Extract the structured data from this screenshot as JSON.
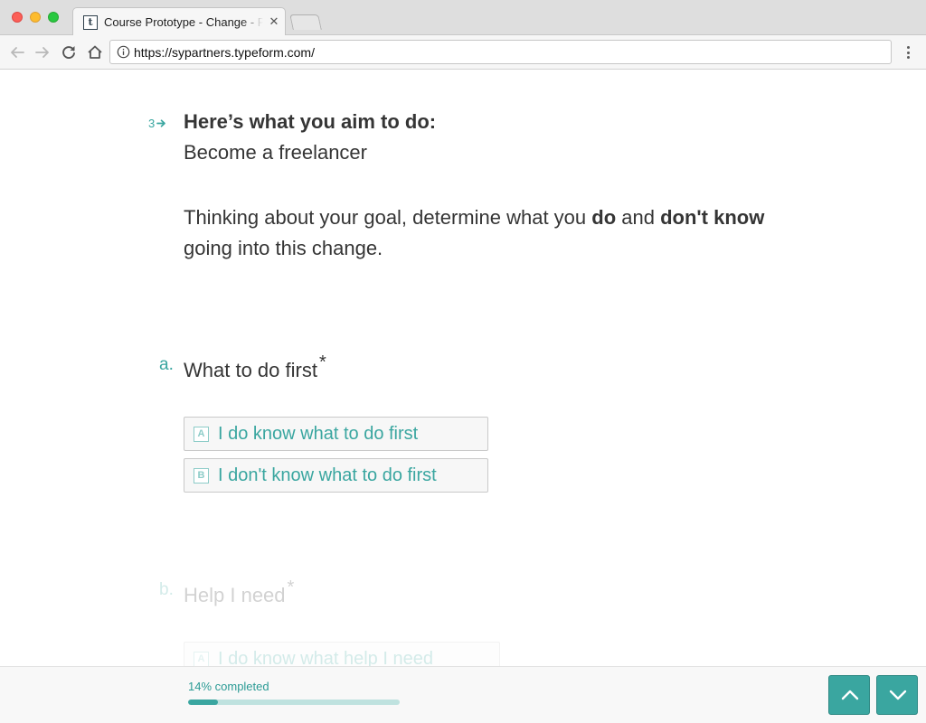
{
  "browser": {
    "tab_title": "Course Prototype - Change - P",
    "tab_favicon_letter": "t",
    "url": "https://sypartners.typeform.com/"
  },
  "question": {
    "number": "3",
    "title": "Here’s what you aim to do:",
    "goal": "Become a freelancer",
    "description_part1": "Thinking about your goal, determine what you ",
    "description_bold1": "do",
    "description_part2": " and ",
    "description_bold2": "don't know",
    "description_part3": " going into this change."
  },
  "subquestions": [
    {
      "letter": "a.",
      "title": "What to do first",
      "required_mark": "*",
      "choices": [
        {
          "key": "A",
          "label": "I do know what to do first"
        },
        {
          "key": "B",
          "label": "I don't know what to do first"
        }
      ]
    },
    {
      "letter": "b.",
      "title": "Help I need",
      "required_mark": "*",
      "choices": [
        {
          "key": "A",
          "label": "I do know what help I need"
        }
      ]
    }
  ],
  "footer": {
    "progress_label": "14% completed",
    "progress_fraction": 0.14
  },
  "colors": {
    "accent": "#3aa6a0",
    "text": "#353535",
    "progress_track": "#bfe2df"
  },
  "icons": {
    "back": "arrow-left-icon",
    "forward": "arrow-right-icon",
    "reload": "reload-icon",
    "home": "home-icon",
    "info": "info-icon",
    "menu": "kebab-menu-icon",
    "next_question": "arrow-right-small-icon",
    "up": "chevron-up-icon",
    "down": "chevron-down-icon"
  }
}
